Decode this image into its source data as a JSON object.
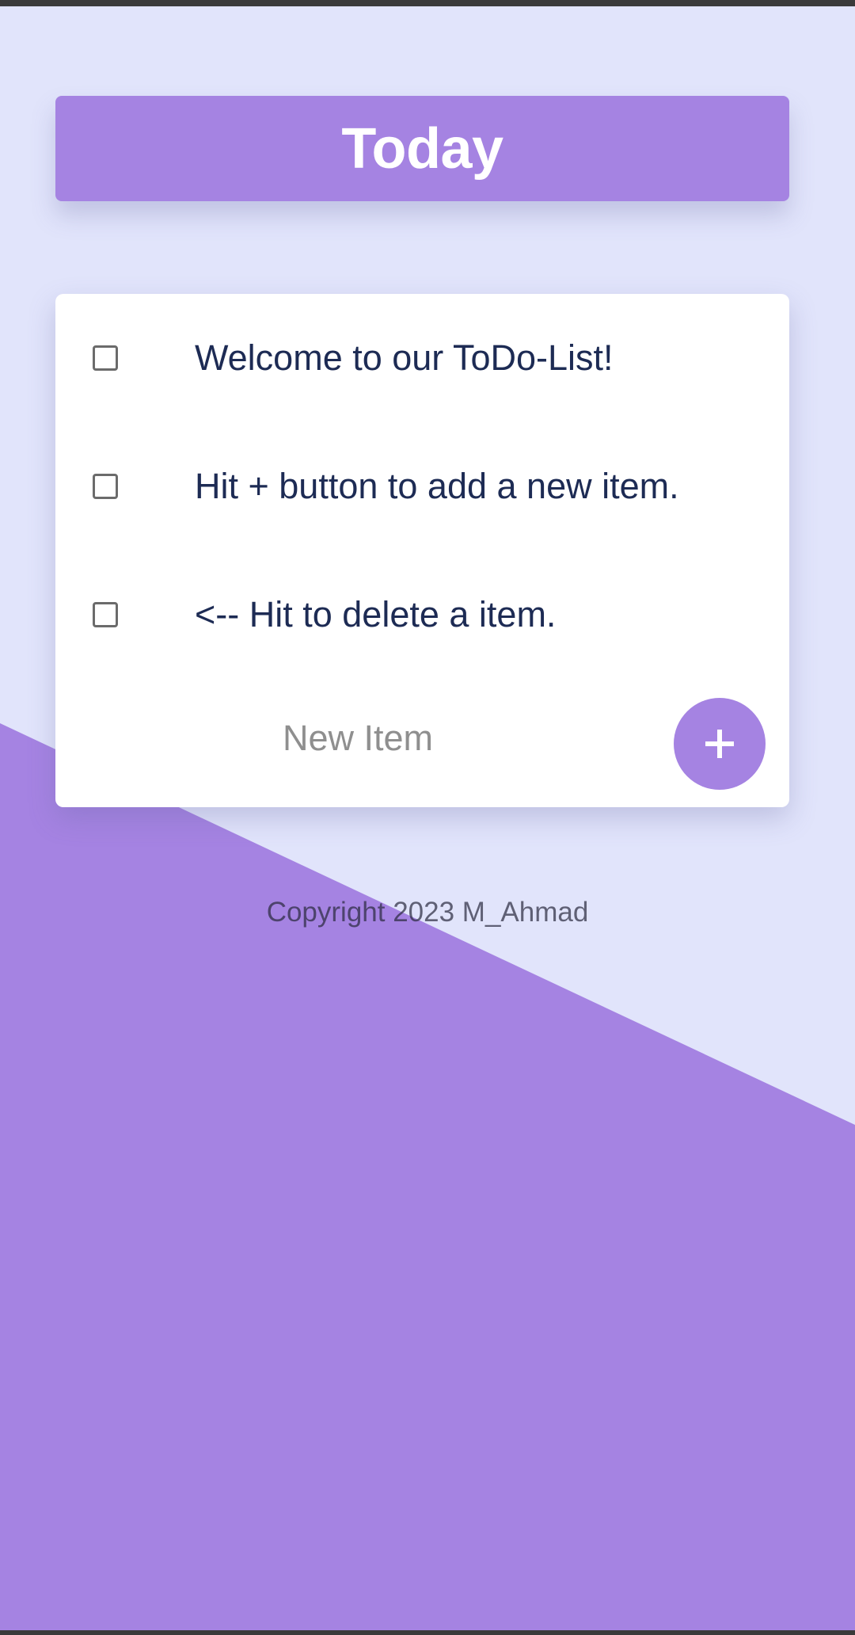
{
  "header": {
    "title": "Today"
  },
  "todo_list": {
    "items": [
      {
        "label": "Welcome to our ToDo-List!",
        "checked": false
      },
      {
        "label": "Hit + button to add a new item.",
        "checked": false
      },
      {
        "label": "<-- Hit to delete a item.",
        "checked": false
      }
    ],
    "new_item": {
      "placeholder": "New Item",
      "value": ""
    },
    "add_button": {
      "label": "+",
      "icon": "plus-icon"
    }
  },
  "footer": {
    "copyright": "Copyright 2023 M_Ahmad"
  },
  "colors": {
    "accent": "#A583E2",
    "background": "#E1E4FB",
    "card": "#FFFFFF",
    "item_text": "#1D2B54"
  }
}
